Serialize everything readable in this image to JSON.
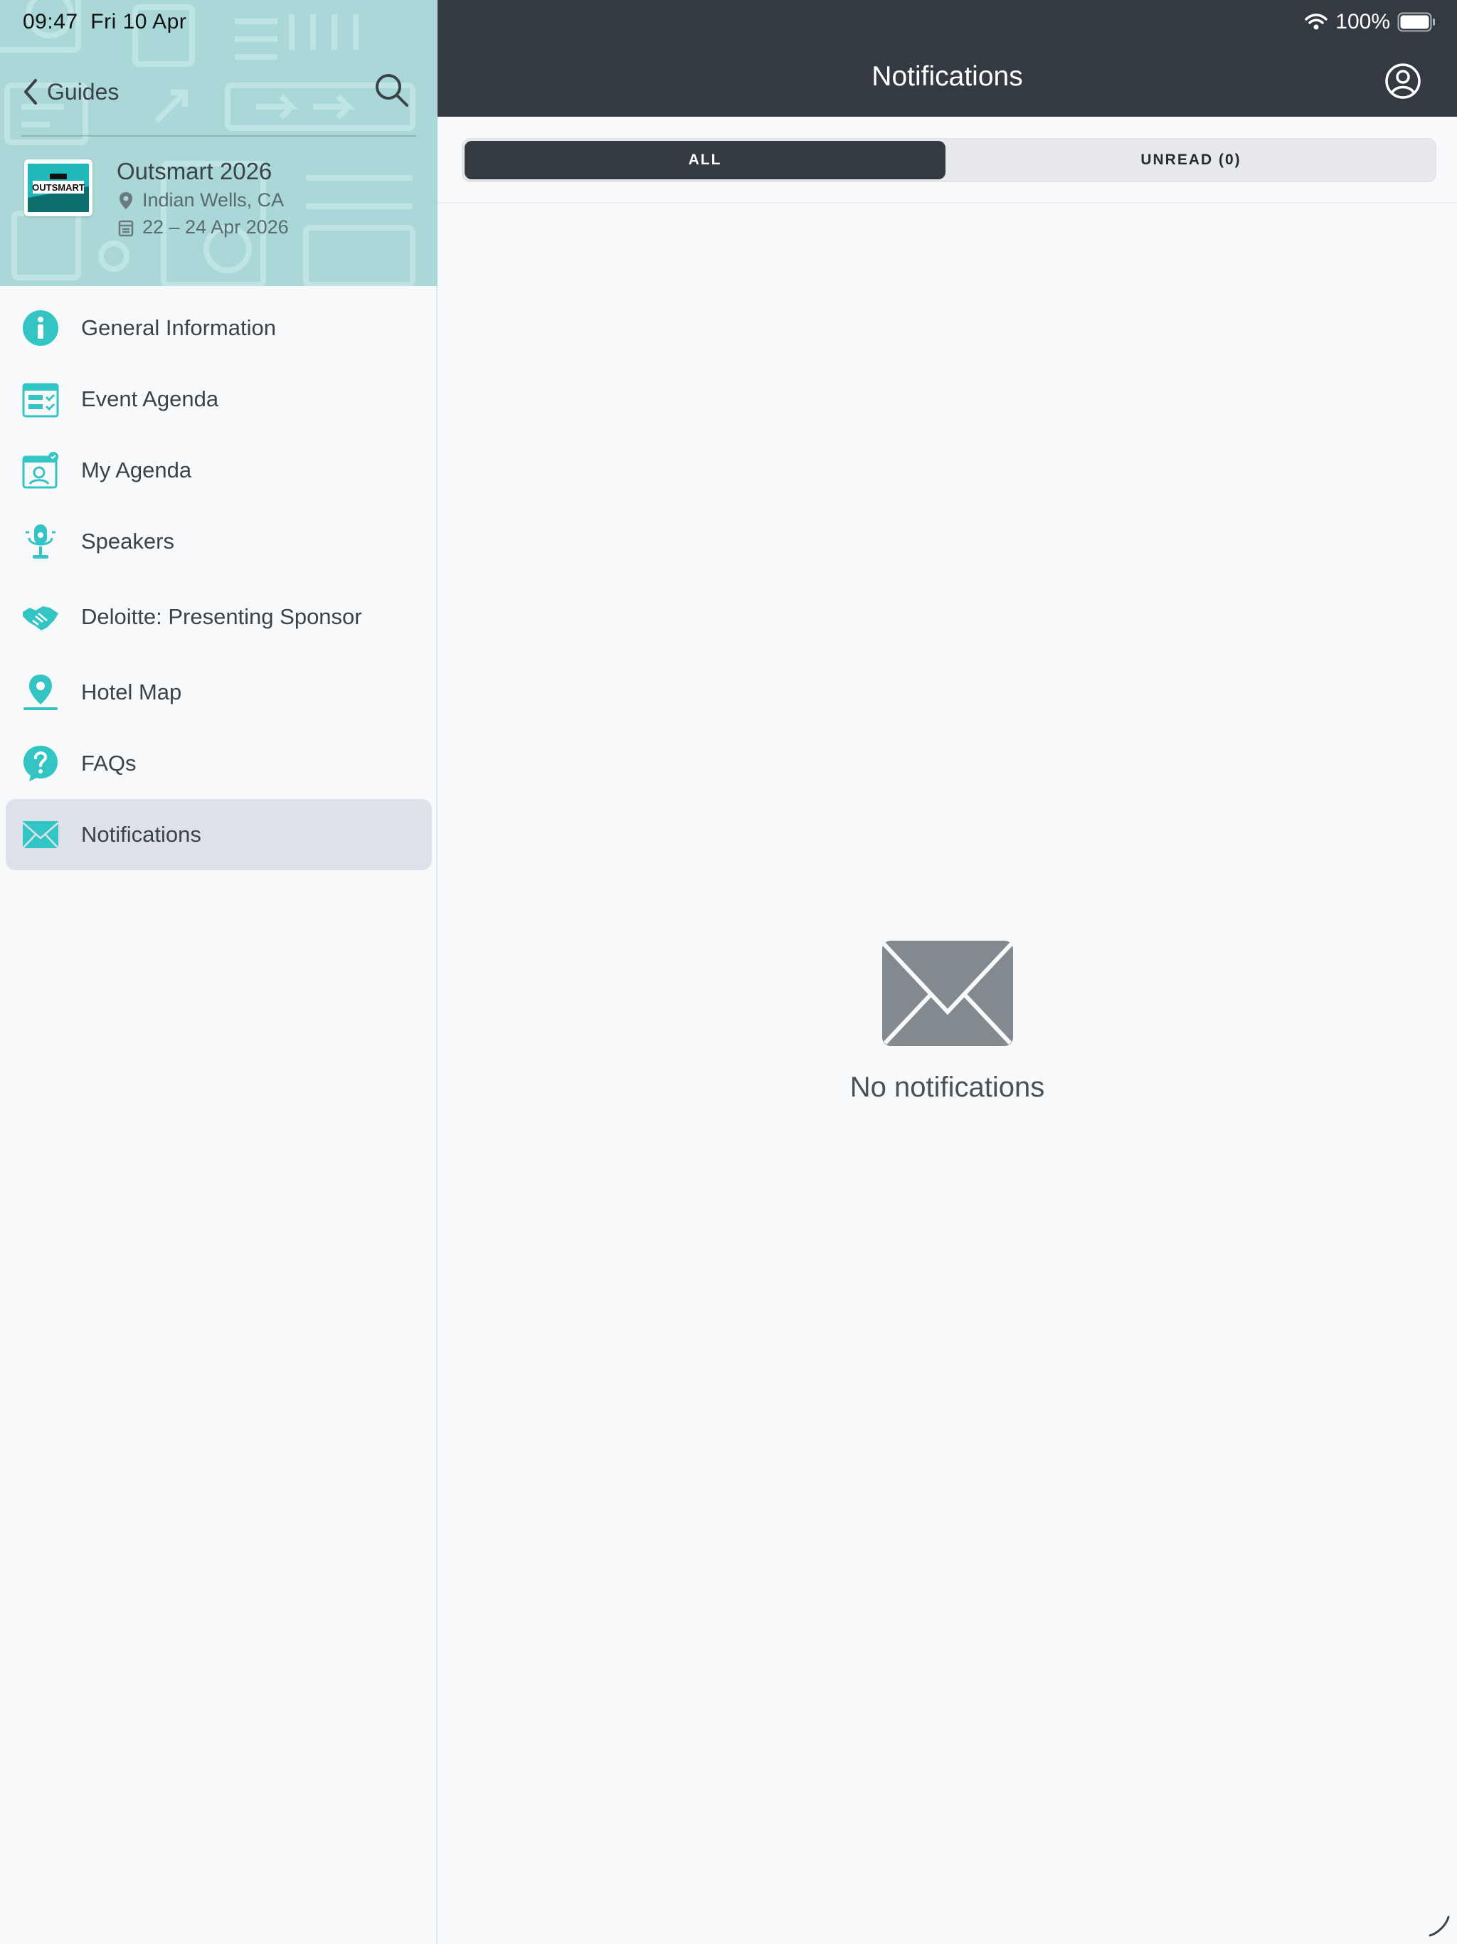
{
  "status_bar": {
    "time": "09:47",
    "date": "Fri 10 Apr",
    "battery": "100%"
  },
  "sidebar": {
    "back_label": "Guides",
    "event": {
      "logo_text": "OUTSMART",
      "title": "Outsmart 2026",
      "location": "Indian Wells, CA",
      "dates": "22 – 24 Apr 2026"
    },
    "items": [
      {
        "label": "General Information",
        "icon": "info-icon"
      },
      {
        "label": "Event Agenda",
        "icon": "calendar-checklist-icon"
      },
      {
        "label": "My Agenda",
        "icon": "personal-calendar-icon"
      },
      {
        "label": "Speakers",
        "icon": "microphone-icon"
      },
      {
        "label": "Deloitte: Presenting Sponsor",
        "icon": "handshake-icon"
      },
      {
        "label": "Hotel Map",
        "icon": "map-pin-icon"
      },
      {
        "label": "FAQs",
        "icon": "question-bubble-icon"
      },
      {
        "label": "Notifications",
        "icon": "envelope-icon",
        "active": true
      }
    ]
  },
  "main": {
    "title": "Notifications",
    "tabs": [
      {
        "label": "ALL",
        "selected": true
      },
      {
        "label": "UNREAD (0)",
        "selected": false
      }
    ],
    "empty_state": "No notifications"
  },
  "colors": {
    "accent": "#33c4c4",
    "topbar": "#343a42",
    "sidebar_header": "#aad8d8",
    "active_item": "#dde1e9"
  }
}
